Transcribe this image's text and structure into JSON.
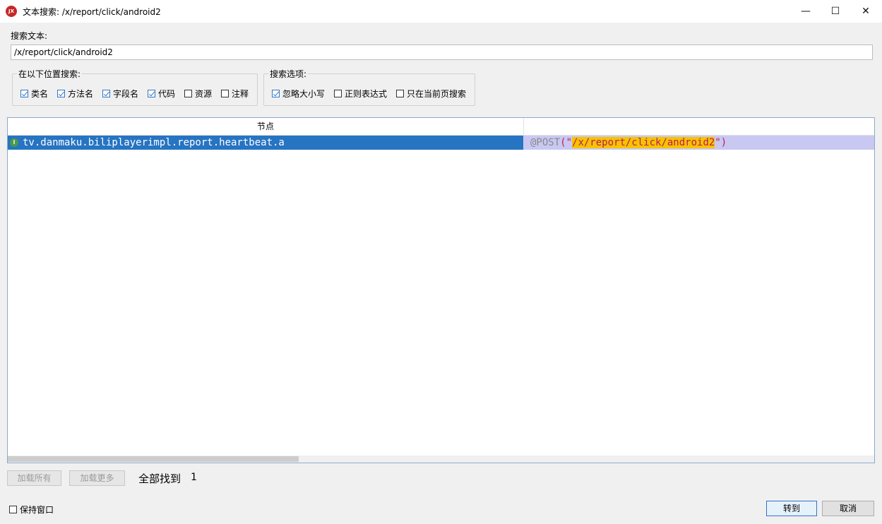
{
  "window": {
    "app_icon": "jadx-icon",
    "app_icon_text": "JX",
    "title": "文本搜索: /x/report/click/android2",
    "minimize_icon": "minimize-icon",
    "maximize_icon": "maximize-icon",
    "close_icon": "close-icon"
  },
  "search": {
    "label": "搜索文本:",
    "value": "/x/report/click/android2"
  },
  "search_in": {
    "title": "在以下位置搜索:",
    "options": [
      {
        "label": "类名",
        "checked": true
      },
      {
        "label": "方法名",
        "checked": true
      },
      {
        "label": "字段名",
        "checked": true
      },
      {
        "label": "代码",
        "checked": true
      },
      {
        "label": "资源",
        "checked": false
      },
      {
        "label": "注释",
        "checked": false
      }
    ]
  },
  "search_options": {
    "title": "搜索选项:",
    "options": [
      {
        "label": "忽略大小写",
        "checked": true
      },
      {
        "label": "正则表达式",
        "checked": false
      },
      {
        "label": "只在当前页搜索",
        "checked": false
      }
    ]
  },
  "results": {
    "column_header": "节点",
    "rows": [
      {
        "icon": "class-icon",
        "icon_text": "I",
        "node": "tv.danmaku.biliplayerimpl.report.heartbeat.a",
        "code_prefix": "@POST",
        "code_open": "(\"",
        "code_match": "/x/report/click/android2",
        "code_close": "\")"
      }
    ]
  },
  "footer": {
    "load_all": "加载所有",
    "load_more": "加载更多",
    "found_label": "全部找到",
    "found_count": "1",
    "keep_window": "保持窗口",
    "keep_window_checked": false,
    "goto": "转到",
    "cancel": "取消"
  },
  "colors": {
    "selection": "#2674c2",
    "match_row_bg": "#c8c8f2",
    "match_highlight": "#f5c400",
    "string_color": "#c2185b"
  }
}
